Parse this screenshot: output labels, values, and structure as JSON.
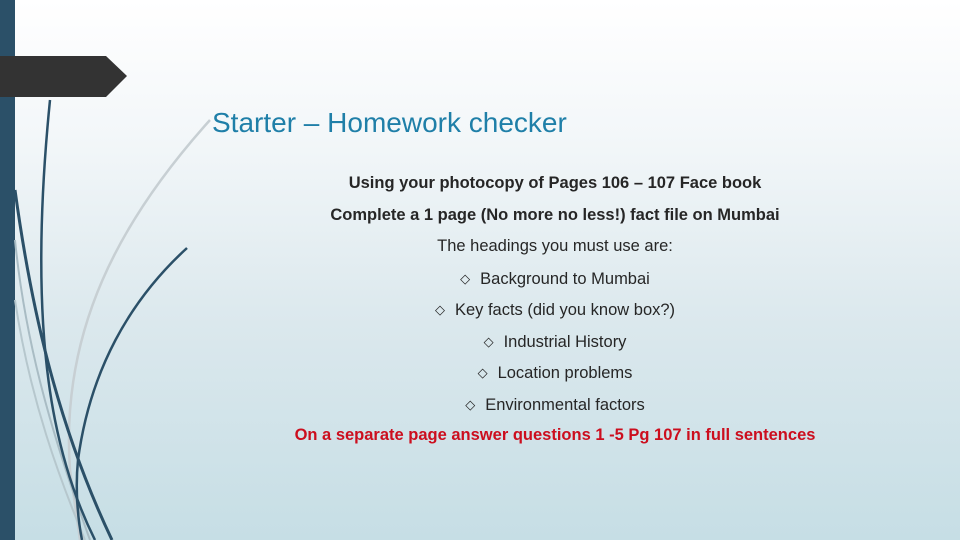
{
  "slide": {
    "title": "Starter – Homework checker",
    "lines": {
      "intro": "Using your photocopy of Pages 106 – 107 Face book",
      "task": "Complete a 1 page (No more no less!) fact file on Mumbai",
      "headings_intro": "The headings you must use are:",
      "closing": "On a separate page answer questions 1 -5 Pg 107 in full sentences"
    },
    "bullets": [
      {
        "icon": "diamond-bullet-icon",
        "glyph": "⯑",
        "label": "Background to Mumbai"
      },
      {
        "icon": "diamond-bullet-icon",
        "glyph": "⯑",
        "label": "Key facts (did you know box?)"
      },
      {
        "icon": "diamond-bullet-icon",
        "glyph": "⯑",
        "label": "Industrial History"
      },
      {
        "icon": "diamond-bullet-icon",
        "glyph": "⯑",
        "label": "Location problems"
      },
      {
        "icon": "diamond-bullet-icon",
        "glyph": "⯑",
        "label": "Environmental factors"
      }
    ]
  },
  "colors": {
    "title": "#1f7fa8",
    "body_text": "#262626",
    "emphasis_red": "#cc0e1e",
    "left_bar": "#2b5068",
    "banner": "#333333"
  }
}
